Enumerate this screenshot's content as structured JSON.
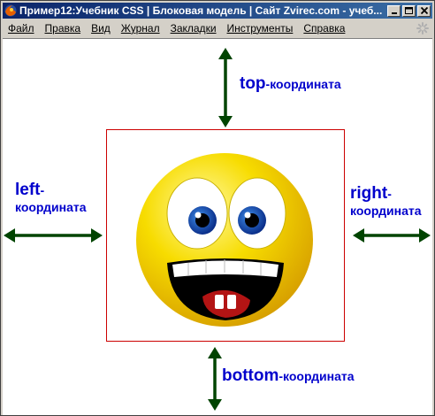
{
  "window": {
    "title": "Пример12:Учебник CSS | Блоковая модель | Сайт Zvirec.com - учеб..."
  },
  "menu": [
    "Файл",
    "Правка",
    "Вид",
    "Журнал",
    "Закладки",
    "Инструменты",
    "Справка"
  ],
  "labels": {
    "top": {
      "main": "top",
      "suffix": "-координата"
    },
    "left": {
      "main": "left",
      "suffix": "-",
      "line2": "координата"
    },
    "right": {
      "main": "right",
      "suffix": "-",
      "line2": "координата"
    },
    "bottom": {
      "main": "bottom",
      "suffix": "-координата"
    }
  },
  "icons": {
    "app": "firefox-icon",
    "minimize": "minimize-icon",
    "maximize": "maximize-icon",
    "close": "close-icon",
    "throbber": "throbber-icon",
    "image": "smiley-icon",
    "arrows": "double-arrow-icon"
  },
  "colors": {
    "arrow": "#004400",
    "label": "#0000cc",
    "box_border": "#cc0000",
    "title_bar": "#0a246a"
  }
}
